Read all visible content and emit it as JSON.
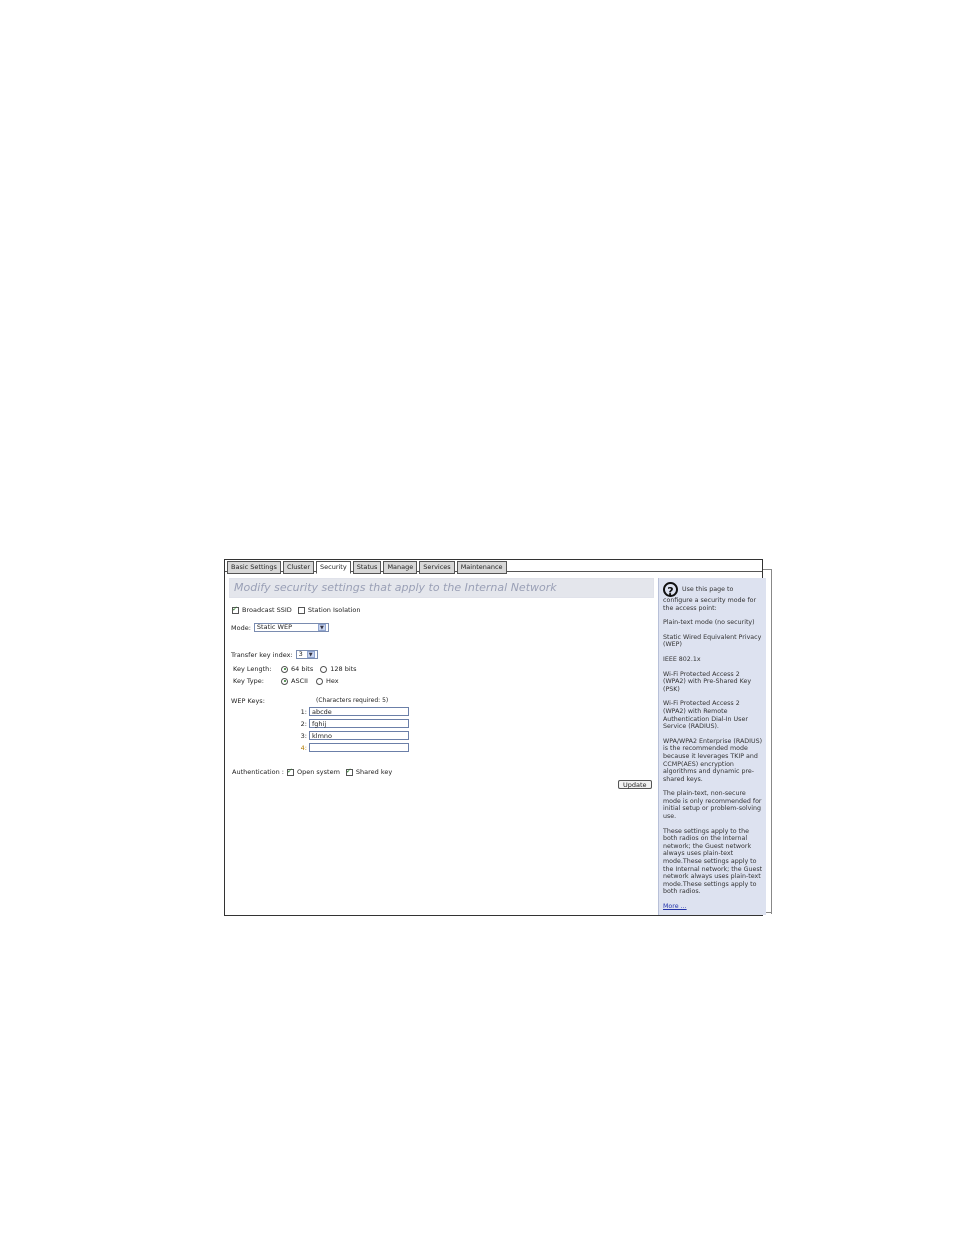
{
  "tabs": [
    {
      "label": "Basic Settings",
      "active": false
    },
    {
      "label": "Cluster",
      "active": false
    },
    {
      "label": "Security",
      "active": true
    },
    {
      "label": "Status",
      "active": false
    },
    {
      "label": "Manage",
      "active": false
    },
    {
      "label": "Services",
      "active": false
    },
    {
      "label": "Maintenance",
      "active": false
    }
  ],
  "heading": "Modify security settings that apply to the Internal Network",
  "broadcast_ssid": {
    "label": "Broadcast SSID",
    "checked": true
  },
  "station_isolation": {
    "label": "Station Isolation",
    "checked": false
  },
  "mode": {
    "label": "Mode:",
    "value": "Static WEP"
  },
  "transfer_key": {
    "label": "Transfer key index:",
    "value": "3"
  },
  "key_length": {
    "label": "Key Length:",
    "opt1": "64 bits",
    "opt2": "128 bits",
    "selected": "64 bits"
  },
  "key_type": {
    "label": "Key Type:",
    "opt1": "ASCII",
    "opt2": "Hex",
    "selected": "ASCII"
  },
  "wep_keys": {
    "label": "WEP Keys:",
    "chars_required": "(Characters required: 5)",
    "keys": [
      {
        "num": "1:",
        "value": "abcde"
      },
      {
        "num": "2:",
        "value": "fghij"
      },
      {
        "num": "3:",
        "value": "klmno"
      },
      {
        "num": "4:",
        "value": ""
      }
    ]
  },
  "authentication": {
    "label": "Authentication :",
    "open_system": {
      "label": "Open system",
      "checked": true
    },
    "shared_key": {
      "label": "Shared key",
      "checked": true
    }
  },
  "update_label": "Update",
  "help": {
    "intro": "Use this page to configure a security mode for the access point:",
    "items": [
      "Plain-text mode (no security)",
      "Static Wired Equivalent Privacy (WEP)",
      "IEEE 802.1x",
      "Wi-Fi Protected Access 2 (WPA2) with Pre-Shared Key (PSK)",
      "Wi-Fi Protected Access 2 (WPA2) with Remote Authentication Dial-In User Service (RADIUS).",
      "WPA/WPA2 Enterprise (RADIUS) is the recommended mode because it leverages TKIP and CCMP(AES) encryption algorithms and dynamic pre-shared keys.",
      "The plain-text, non-secure mode is only recommended for initial setup or problem-solving use.",
      "These settings apply to the both radios on the Internal network; the Guest network always uses plain-text mode.These settings apply to the Internal network; the Guest network always uses plain-text mode.These settings apply to both radios."
    ],
    "more_label": "More ..."
  }
}
